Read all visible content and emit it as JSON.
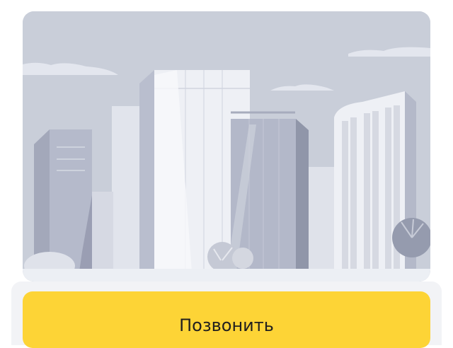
{
  "illustration": {
    "subject": "city-skyline",
    "colors": {
      "sky": "#c9ced9",
      "ground": "#eceff4",
      "building_light": "#e8ebf2",
      "building_mid": "#b4b9c8",
      "building_dark": "#959bae"
    }
  },
  "call_button": {
    "label": "Позвонить",
    "color": "#fdd436"
  }
}
